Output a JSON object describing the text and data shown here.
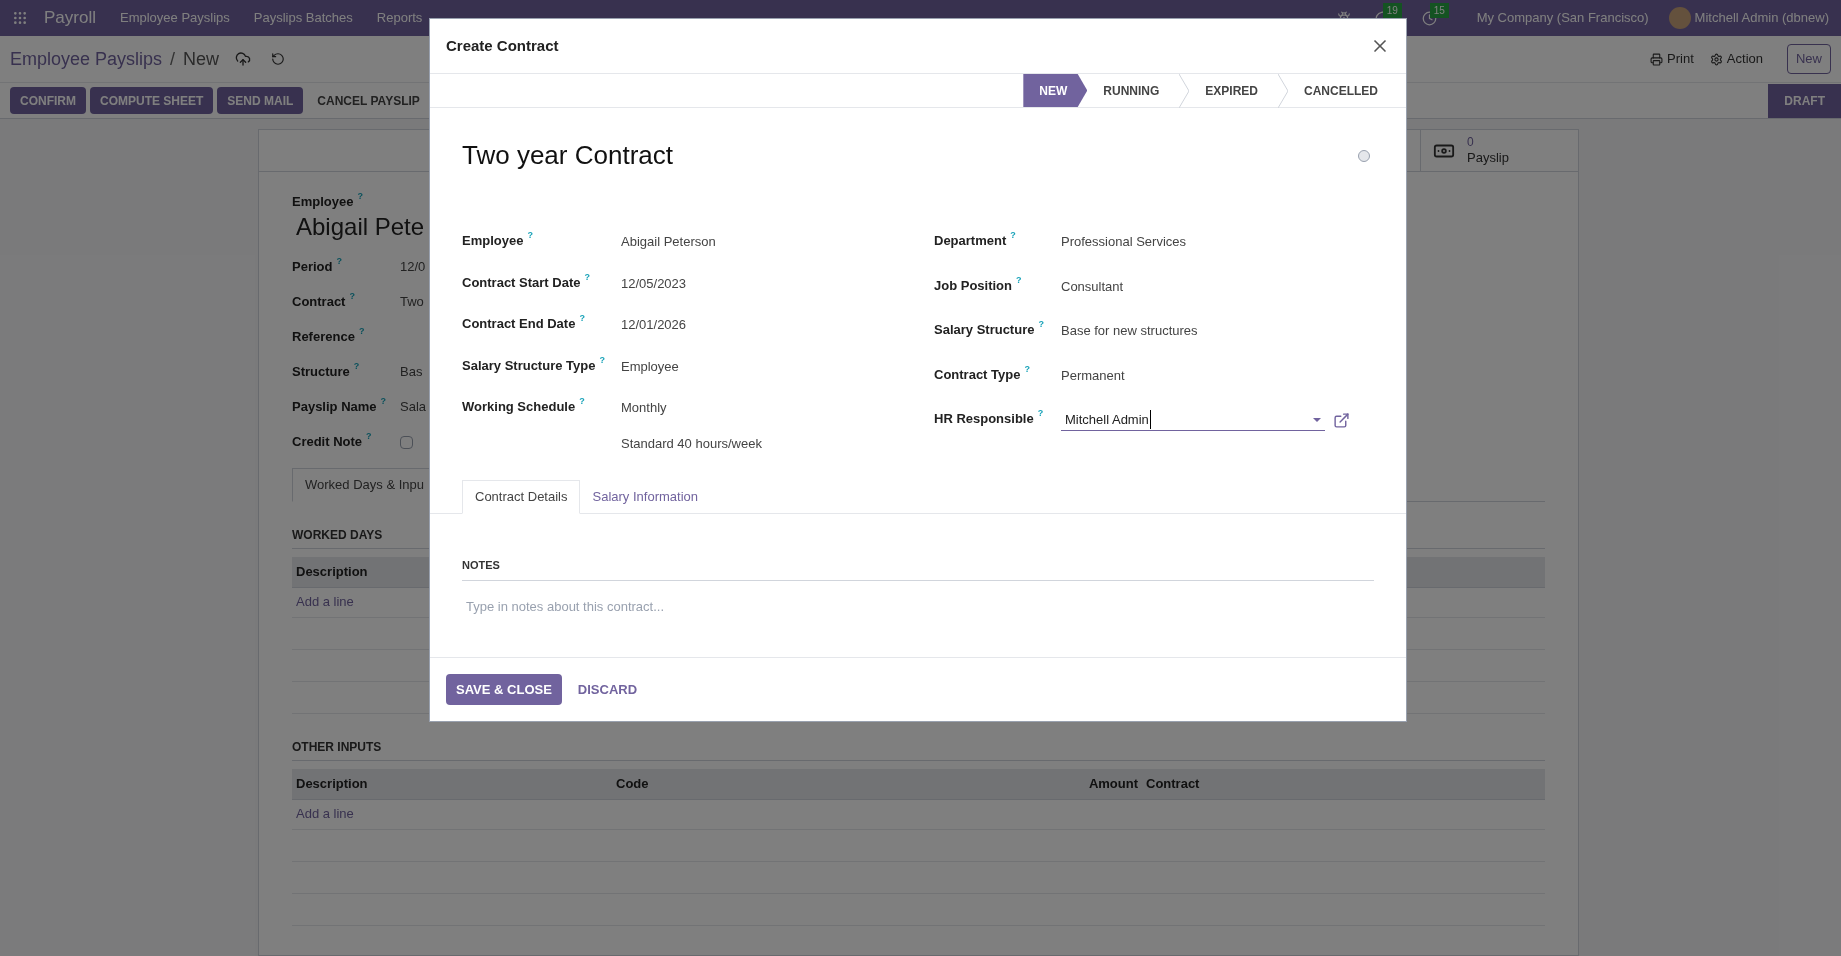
{
  "navbar": {
    "app_name": "Payroll",
    "menu": [
      "Employee Payslips",
      "Payslips Batches",
      "Reports"
    ],
    "chat_count": "19",
    "activity_count": "15",
    "company": "My Company (San Francisco)",
    "user": "Mitchell Admin (dbnew)"
  },
  "control_panel": {
    "breadcrumb": "Employee Payslips",
    "separator": "/",
    "current": "New",
    "print": "Print",
    "action": "Action",
    "new_button": "New",
    "buttons": [
      "CONFIRM",
      "COMPUTE SHEET",
      "SEND MAIL"
    ],
    "cancel_button": "CANCEL PAYSLIP",
    "status": "DRAFT"
  },
  "sheet": {
    "stat": {
      "value": "0",
      "label": "Payslip"
    },
    "employee_label": "Employee",
    "help": "?",
    "employee_name": "Abigail Pete",
    "fields": [
      {
        "kind": "text",
        "label": "Period",
        "value": "12/0"
      },
      {
        "kind": "text",
        "label": "Contract",
        "value": "Two"
      },
      {
        "kind": "text",
        "label": "Reference"
      },
      {
        "kind": "text",
        "label": "Structure",
        "value": "Bas"
      },
      {
        "kind": "text",
        "label": "Payslip Name",
        "value": "Sala"
      },
      {
        "kind": "checkbox",
        "label": "Credit Note",
        "checked": false
      }
    ],
    "tab": "Worked Days & Inpu",
    "worked_days": {
      "title": "WORKED DAYS",
      "columns": [
        "Description"
      ],
      "add_line": "Add a line"
    },
    "other_inputs": {
      "title": "OTHER INPUTS",
      "columns": [
        "Description",
        "Code",
        "Amount",
        "Contract"
      ],
      "add_line": "Add a line"
    }
  },
  "modal": {
    "title": "Create Contract",
    "stages": [
      {
        "label": "NEW",
        "selected": true
      },
      {
        "label": "RUNNING",
        "selected": false
      },
      {
        "label": "EXPIRED",
        "selected": false
      },
      {
        "label": "CANCELLED",
        "selected": false
      }
    ],
    "name": "Two year Contract",
    "help": "?",
    "left_fields": [
      {
        "label": "Employee",
        "values": [
          "Abigail Peterson"
        ]
      },
      {
        "label": "Contract Start Date",
        "values": [
          "12/05/2023"
        ]
      },
      {
        "label": "Contract End Date",
        "values": [
          "12/01/2026"
        ]
      },
      {
        "label": "Salary Structure Type",
        "values": [
          "Employee"
        ]
      },
      {
        "label": "Working Schedule",
        "values": [
          "Monthly",
          "Standard 40 hours/week"
        ]
      }
    ],
    "right_fields": [
      {
        "label": "Department",
        "value": "Professional Services",
        "kind": "text"
      },
      {
        "label": "Job Position",
        "value": "Consultant",
        "kind": "text"
      },
      {
        "label": "Salary Structure",
        "value": "Base for new structures",
        "kind": "text"
      },
      {
        "label": "Contract Type",
        "value": "Permanent",
        "kind": "text"
      },
      {
        "label": "HR Responsible",
        "value": "Mitchell Admin",
        "kind": "many2one"
      }
    ],
    "tabs": [
      {
        "label": "Contract Details",
        "selected": true
      },
      {
        "label": "Salary Information",
        "selected": false
      }
    ],
    "notes_title": "NOTES",
    "notes_placeholder": "Type in notes about this contract...",
    "save_button": "SAVE & CLOSE",
    "discard_button": "DISCARD"
  }
}
